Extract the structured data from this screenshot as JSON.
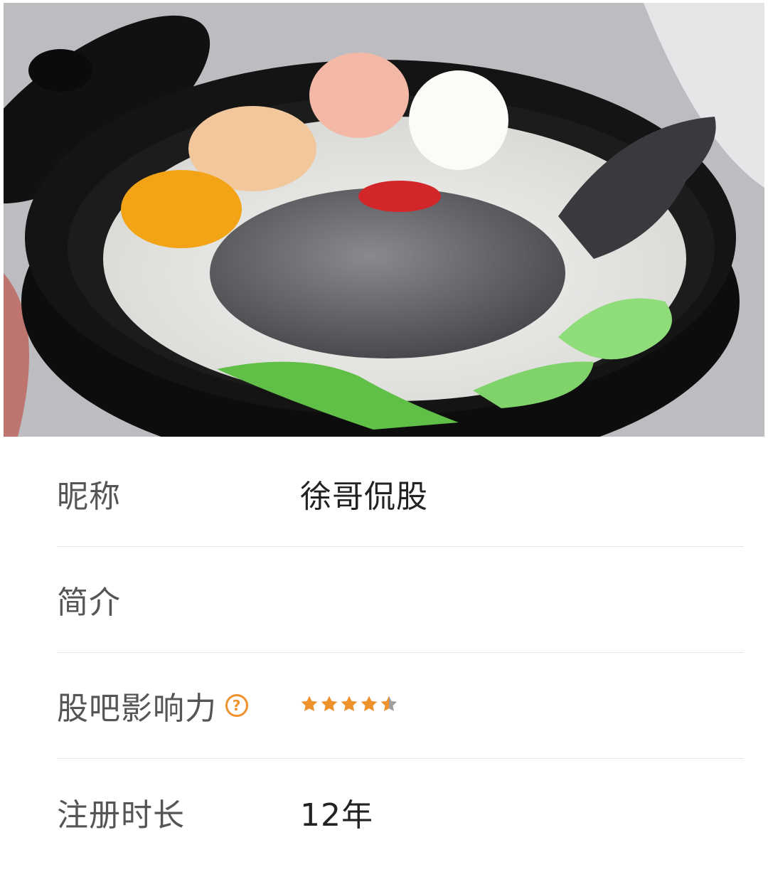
{
  "profile": {
    "nickname_label": "昵称",
    "nickname_value": "徐哥侃股",
    "intro_label": "简介",
    "intro_value": "",
    "influence_label": "股吧影响力",
    "influence_help_icon": "question-circle-icon",
    "influence_rating": 4.5,
    "influence_max": 5,
    "register_label": "注册时长",
    "register_value": "12年"
  },
  "colors": {
    "accent": "#f0922c",
    "star_empty": "#9e9e9e",
    "label": "#555555",
    "value": "#222222",
    "divider": "#e6e6e6"
  }
}
